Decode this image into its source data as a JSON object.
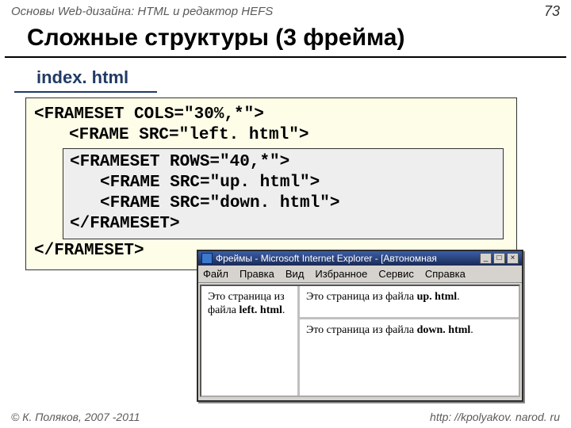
{
  "header": {
    "breadcrumb": "Основы Web-дизайна: HTML и редактор HEFS",
    "page_number": "73"
  },
  "title": "Сложные структуры (3 фрейма)",
  "filename": "index. html",
  "code": {
    "l1": "<FRAMESET COLS=\"30%,*\">",
    "l2": "<FRAME SRC=\"left. html\">",
    "inner": {
      "l1": "<FRAMESET ROWS=\"40,*\">",
      "l2": "<FRAME SRC=\"up. html\">",
      "l3": "<FRAME SRC=\"down. html\">",
      "l4": "</FRAMESET>"
    },
    "l3": "</FRAMESET>"
  },
  "browser": {
    "title": "Фреймы - Microsoft Internet Explorer - [Автономная",
    "btn_min": "_",
    "btn_max": "□",
    "btn_close": "×",
    "menus": [
      "Файл",
      "Правка",
      "Вид",
      "Избранное",
      "Сервис",
      "Справка"
    ],
    "left_a": "Это страница из файла ",
    "left_b": "left. html",
    "up_a": "Это страница из файла ",
    "up_b": "up. html",
    "down_a": "Это страница из файла ",
    "down_b": "down. html"
  },
  "footer": {
    "copyright": "© К. Поляков, 2007 -2011",
    "url": "http: //kpolyakov. narod. ru"
  }
}
